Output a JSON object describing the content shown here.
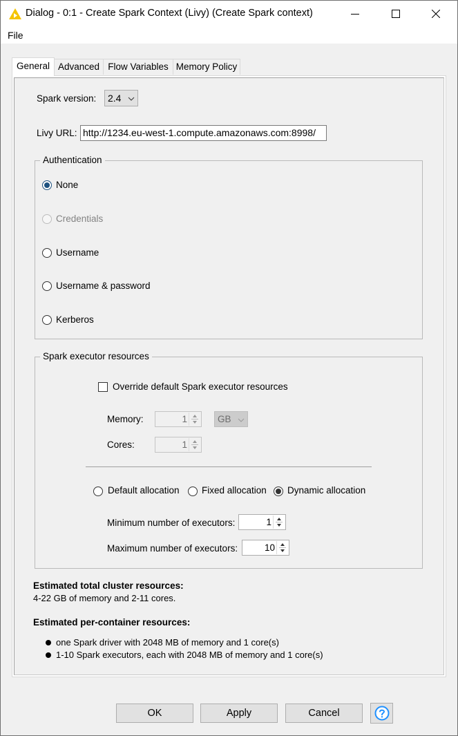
{
  "window": {
    "title": "Dialog - 0:1 - Create Spark Context (Livy) (Create Spark context)",
    "app_icon": "knime-triangle-icon",
    "accent_color": "#f5c400",
    "controls": {
      "minimize": "minimize-icon",
      "maximize": "maximize-icon",
      "close": "close-icon"
    }
  },
  "menubar": {
    "items": [
      {
        "label": "File"
      }
    ]
  },
  "tabs": [
    {
      "label": "General",
      "active": true
    },
    {
      "label": "Advanced",
      "active": false
    },
    {
      "label": "Flow Variables",
      "active": false
    },
    {
      "label": "Memory Policy",
      "active": false
    }
  ],
  "general": {
    "spark_version": {
      "label": "Spark version:",
      "value": "2.4"
    },
    "livy_url": {
      "label": "Livy URL:",
      "value": "http://1234.eu-west-1.compute.amazonaws.com:8998/"
    },
    "authentication": {
      "title": "Authentication",
      "options": [
        {
          "label": "None",
          "selected": true,
          "enabled": true
        },
        {
          "label": "Credentials",
          "selected": false,
          "enabled": false
        },
        {
          "label": "Username",
          "selected": false,
          "enabled": true
        },
        {
          "label": "Username & password",
          "selected": false,
          "enabled": true
        },
        {
          "label": "Kerberos",
          "selected": false,
          "enabled": true
        }
      ]
    },
    "executor_resources": {
      "title": "Spark executor resources",
      "override_label": "Override default Spark executor resources",
      "override_checked": false,
      "memory": {
        "label": "Memory:",
        "value": "1",
        "unit": "GB"
      },
      "cores": {
        "label": "Cores:",
        "value": "1"
      },
      "allocation_options": [
        {
          "label": "Default allocation",
          "selected": false
        },
        {
          "label": "Fixed allocation",
          "selected": false
        },
        {
          "label": "Dynamic allocation",
          "selected": true
        }
      ],
      "min_executors": {
        "label": "Minimum number of executors:",
        "value": "1"
      },
      "max_executors": {
        "label": "Maximum number of executors:",
        "value": "10"
      }
    },
    "estimates": {
      "total_heading": "Estimated total cluster resources:",
      "total_text": "4-22 GB of memory and 2-11 cores.",
      "per_container_heading": "Estimated per-container resources:",
      "per_container_items": [
        "one Spark driver with 2048 MB of memory and 1 core(s)",
        "1-10 Spark executors, each with 2048 MB of memory and 1 core(s)"
      ]
    }
  },
  "buttons": {
    "ok": "OK",
    "apply": "Apply",
    "cancel": "Cancel",
    "help_icon": "help-icon",
    "help_color": "#1e90ff"
  }
}
